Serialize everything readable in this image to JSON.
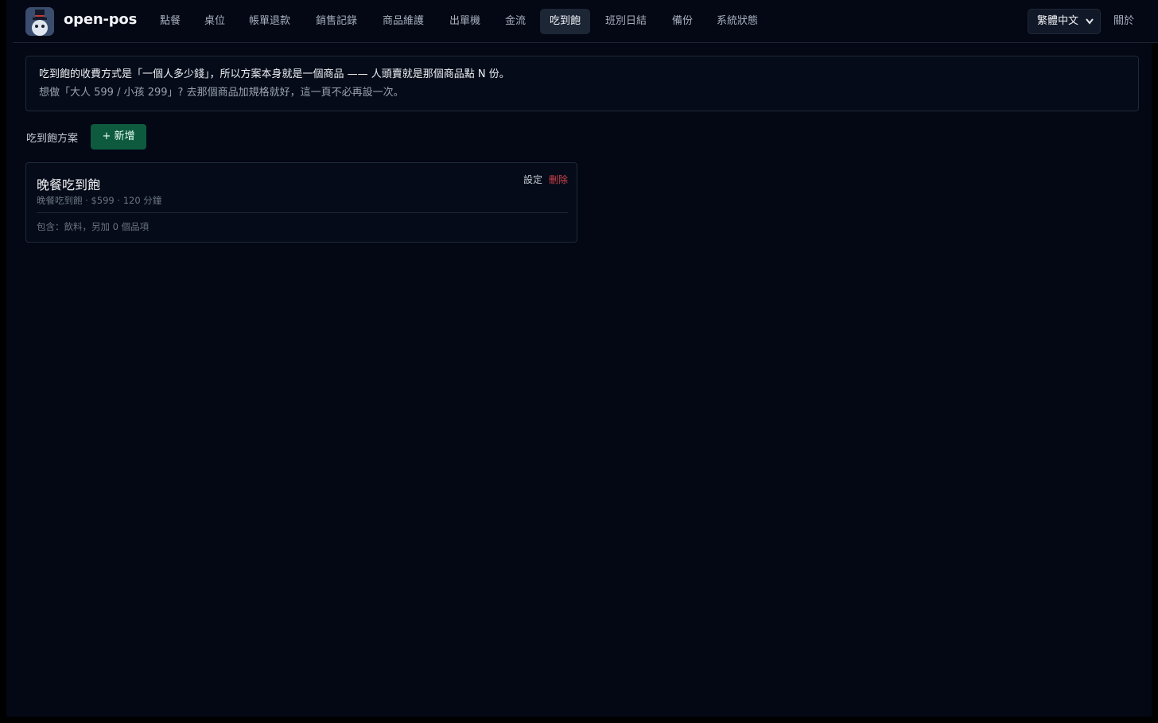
{
  "app": {
    "name": "open-pos"
  },
  "nav": {
    "items": [
      {
        "label": "點餐"
      },
      {
        "label": "桌位"
      },
      {
        "label": "帳單退款"
      },
      {
        "label": "銷售記錄"
      },
      {
        "label": "商品維護"
      },
      {
        "label": "出單機"
      },
      {
        "label": "金流"
      },
      {
        "label": "吃到飽",
        "active": true
      },
      {
        "label": "班別日結"
      },
      {
        "label": "備份"
      },
      {
        "label": "系統狀態"
      }
    ],
    "language": "繁體中文",
    "about": "關於"
  },
  "notice": {
    "line1": "吃到飽的收費方式是「一個人多少錢」，所以方案本身就是一個商品 —— 人頭賣就是那個商品點 N 份。",
    "line2": "想做「大人 599 / 小孩 299」? 去那個商品加規格就好，這一頁不必再設一次。"
  },
  "plans": {
    "section_label": "吃到飽方案",
    "add_label": "+ 新增",
    "items": [
      {
        "title": "晚餐吃到飽",
        "subtitle": "晚餐吃到飽 · $599 · 120 分鐘",
        "edit_label": "設定",
        "delete_label": "刪除",
        "includes": "包含：飲料，另加 0 個品項"
      }
    ]
  },
  "colors": {
    "background": "#040714",
    "accent_green": "#0d5a3f",
    "danger": "#d2434b",
    "active_tab": "#1c2635"
  }
}
